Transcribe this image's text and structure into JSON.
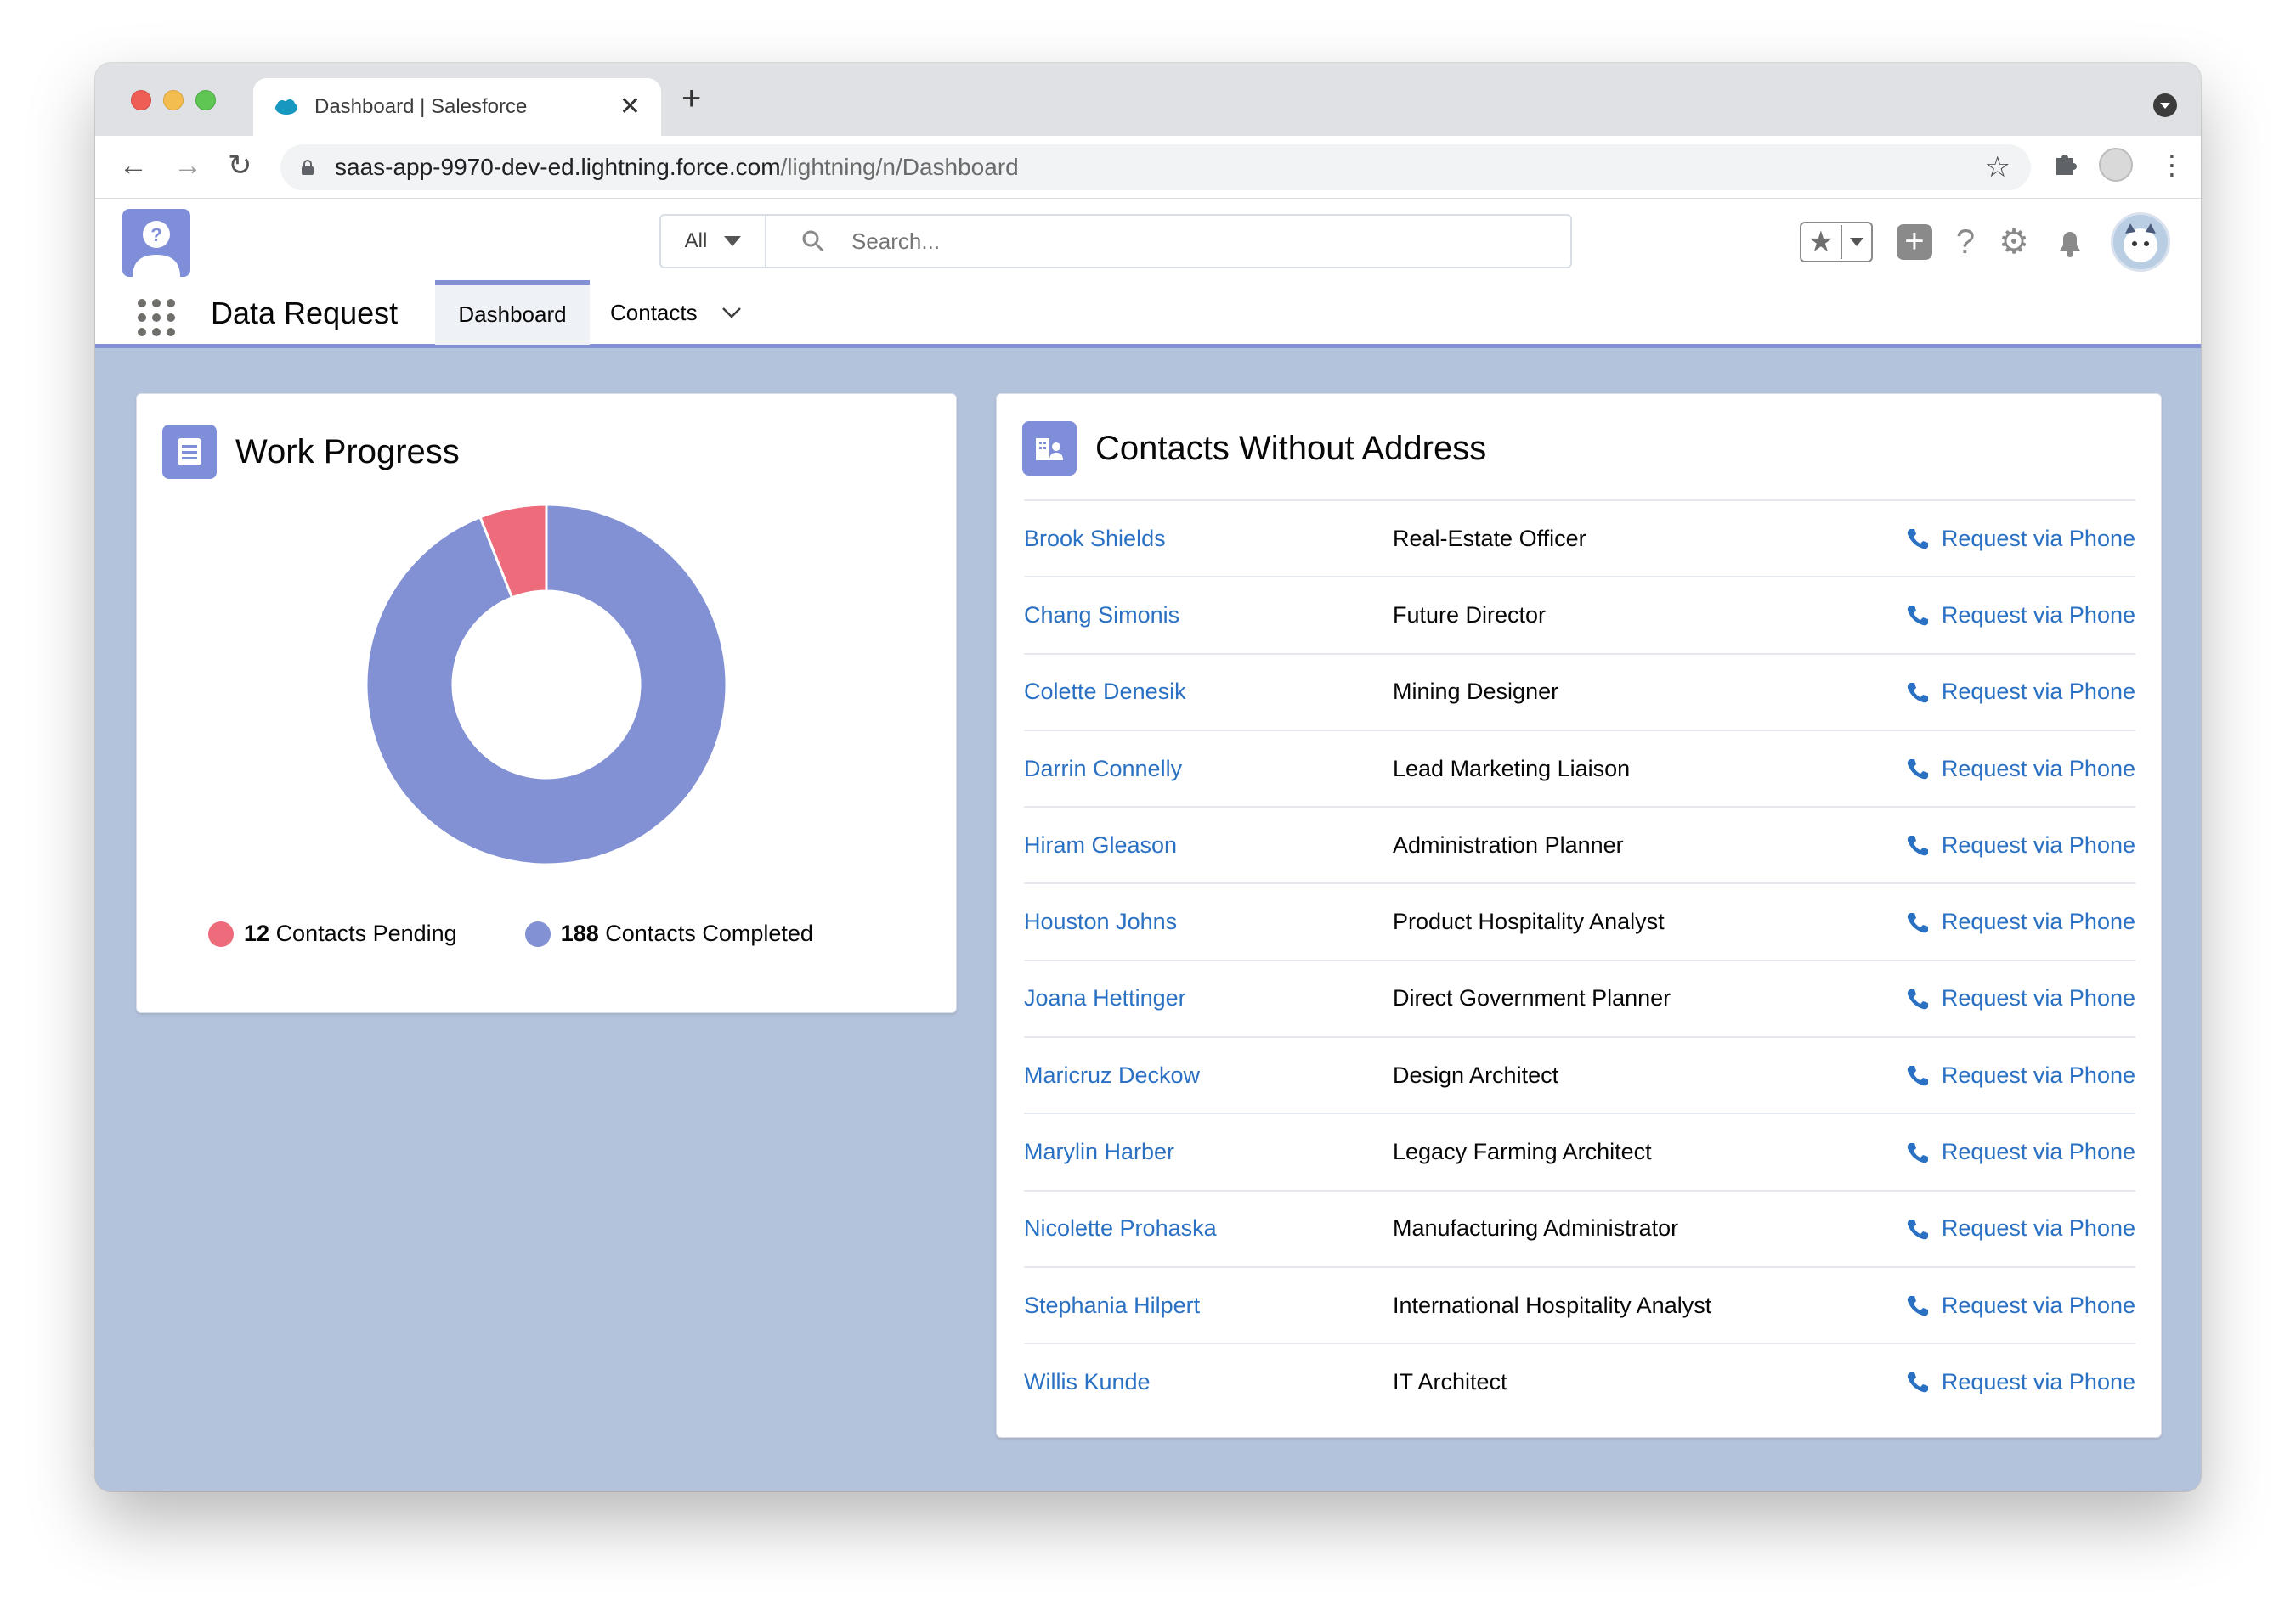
{
  "browser": {
    "tab_title": "Dashboard | Salesforce",
    "close_glyph": "✕",
    "newtab_glyph": "+",
    "url_host": "saas-app-9970-dev-ed.lightning.force.com",
    "url_path": "/lightning/n/Dashboard",
    "back_glyph": "←",
    "forward_glyph": "→",
    "reload_glyph": "↻",
    "star_glyph": "☆",
    "kebab_glyph": "⋮"
  },
  "header": {
    "search_scope": "All",
    "search_placeholder": "Search...",
    "app_name": "Data Request",
    "tabs": [
      {
        "label": "Dashboard",
        "active": true
      },
      {
        "label": "Contacts",
        "active": false
      }
    ]
  },
  "work_progress": {
    "title": "Work Progress",
    "legend": [
      {
        "count": "12",
        "label": "Contacts Pending",
        "color": "#ee6b7c"
      },
      {
        "count": "188",
        "label": "Contacts Completed",
        "color": "#8290d4"
      }
    ]
  },
  "chart_data": {
    "type": "pie",
    "donut": true,
    "categories": [
      "Contacts Pending",
      "Contacts Completed"
    ],
    "values": [
      12,
      188
    ],
    "colors": [
      "#ee6b7c",
      "#8290d4"
    ]
  },
  "contacts_card": {
    "title": "Contacts Without Address",
    "action_label": "Request via Phone",
    "rows": [
      {
        "name": "Brook Shields",
        "title": "Real-Estate Officer"
      },
      {
        "name": "Chang Simonis",
        "title": "Future Director"
      },
      {
        "name": "Colette Denesik",
        "title": "Mining Designer"
      },
      {
        "name": "Darrin Connelly",
        "title": "Lead Marketing Liaison"
      },
      {
        "name": "Hiram Gleason",
        "title": "Administration Planner"
      },
      {
        "name": "Houston Johns",
        "title": "Product Hospitality Analyst"
      },
      {
        "name": "Joana Hettinger",
        "title": "Direct Government Planner"
      },
      {
        "name": "Maricruz Deckow",
        "title": "Design Architect"
      },
      {
        "name": "Marylin Harber",
        "title": "Legacy Farming Architect"
      },
      {
        "name": "Nicolette Prohaska",
        "title": "Manufacturing Administrator"
      },
      {
        "name": "Stephania Hilpert",
        "title": "International Hospitality Analyst"
      },
      {
        "name": "Willis Kunde",
        "title": "IT Architect"
      }
    ]
  },
  "colors": {
    "accent": "#8290d4",
    "pending": "#ee6b7c",
    "link": "#2a70c3",
    "page_bg": "#b4c3dc"
  },
  "icons": {
    "header": [
      "favorites-star-icon",
      "add-icon",
      "help-icon",
      "setup-gear-icon",
      "notifications-bell-icon",
      "user-avatar"
    ],
    "card_progress": "report-list-icon",
    "card_contacts": "contact-building-icon",
    "row_action": "phone-icon"
  }
}
